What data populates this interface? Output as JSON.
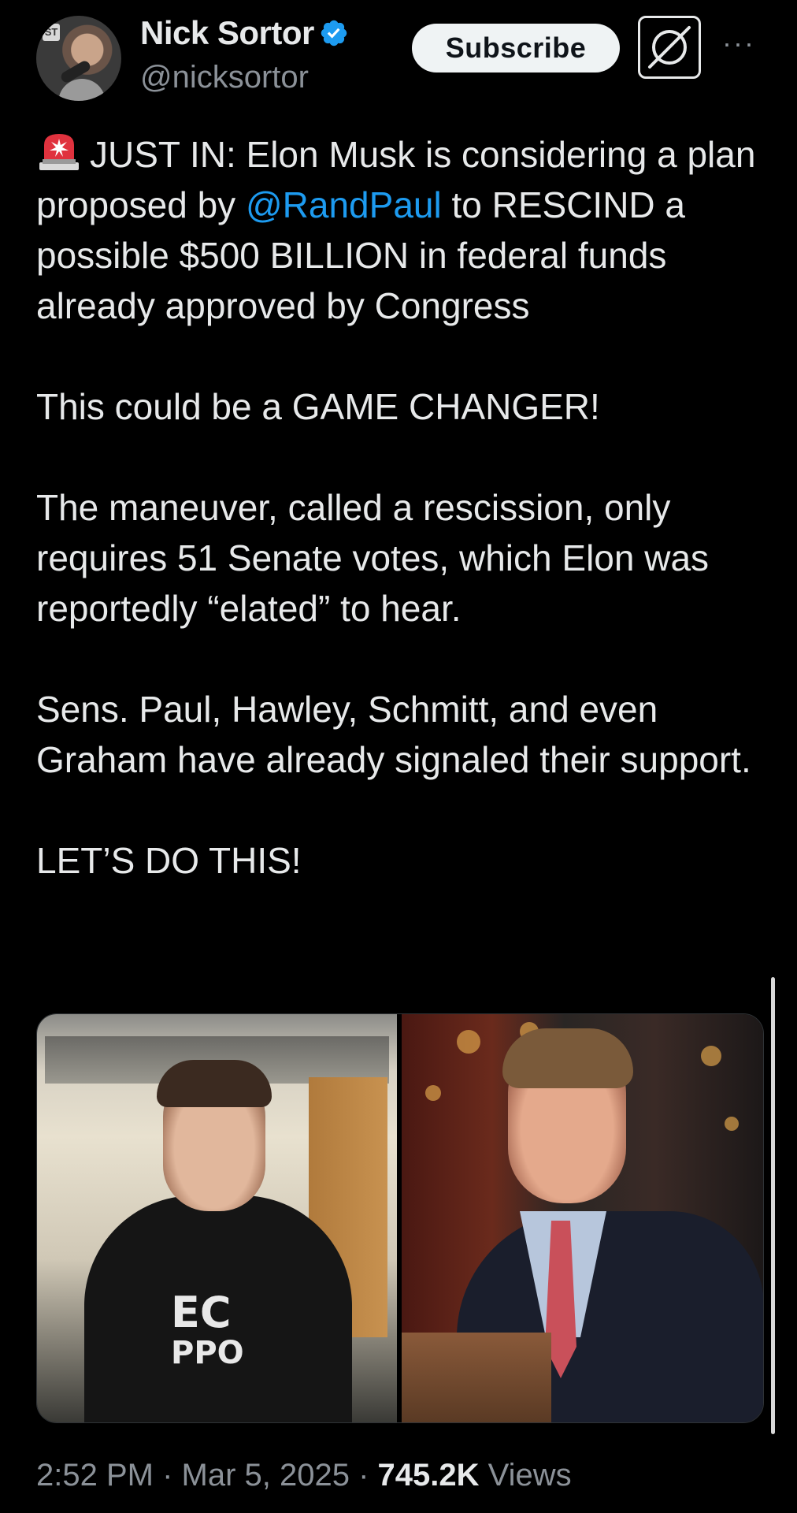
{
  "author": {
    "display_name": "Nick Sortor",
    "handle": "@nicksortor",
    "verified": true,
    "avatar_sign_text": "ST"
  },
  "actions": {
    "subscribe_label": "Subscribe",
    "more_label": "···"
  },
  "tweet": {
    "para1_before_mention": "JUST IN: Elon Musk is considering a plan proposed by ",
    "mention": "@RandPaul",
    "para1_after_mention": " to RESCIND a possible $500 BILLION in federal funds already approved by Congress",
    "para2": "This could be a GAME CHANGER!",
    "para3": "The maneuver, called a rescission, only requires 51 Senate votes, which Elon was reportedly “elated” to hear.",
    "para4": "Sens. Paul, Hawley, Schmitt, and even Graham have already signaled their support.",
    "para5": "LET’S DO THIS!"
  },
  "media": {
    "left_shirt_line1": "EC",
    "left_shirt_line2": "PPO"
  },
  "meta": {
    "time": "2:52 PM",
    "separator": " · ",
    "date": "Mar 5, 2025",
    "views_count": "745.2K",
    "views_label": " Views"
  },
  "colors": {
    "background": "#000000",
    "text": "#e7e9ea",
    "secondary": "#8b9198",
    "link": "#1d9bf0",
    "verified": "#1d9bf0"
  }
}
